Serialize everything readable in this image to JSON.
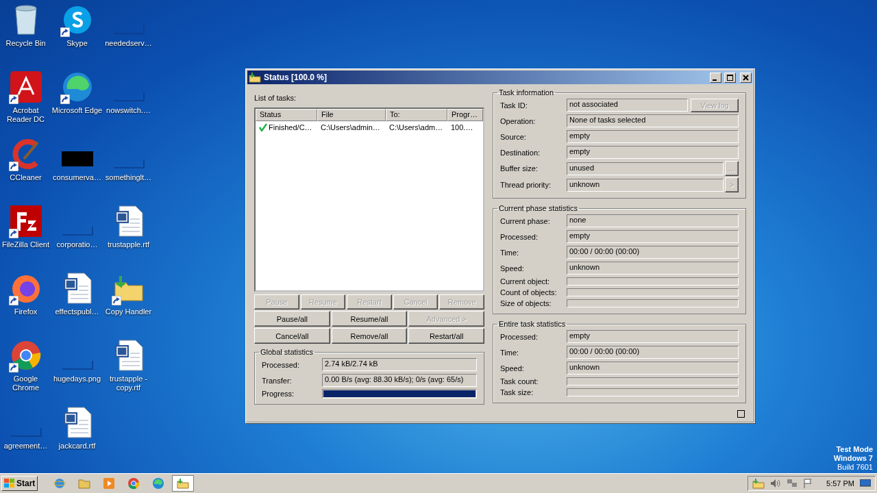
{
  "desktop_icons": [
    {
      "label": "Recycle Bin",
      "kind": "recycle",
      "shortcut": false
    },
    {
      "label": "Acrobat Reader DC",
      "kind": "acrobat",
      "shortcut": true
    },
    {
      "label": "CCleaner",
      "kind": "ccleaner",
      "shortcut": true
    },
    {
      "label": "FileZilla Client",
      "kind": "filezilla",
      "shortcut": true
    },
    {
      "label": "Firefox",
      "kind": "firefox",
      "shortcut": true
    },
    {
      "label": "Google Chrome",
      "kind": "chrome",
      "shortcut": true
    },
    {
      "label": "agreement…",
      "kind": "blank",
      "shortcut": false
    },
    {
      "label": "Skype",
      "kind": "skype",
      "shortcut": true
    },
    {
      "label": "Microsoft Edge",
      "kind": "edge",
      "shortcut": true
    },
    {
      "label": "consumerva…",
      "kind": "black",
      "shortcut": false
    },
    {
      "label": "corporatio…",
      "kind": "blank",
      "shortcut": false
    },
    {
      "label": "effectspubl…",
      "kind": "word",
      "shortcut": false
    },
    {
      "label": "hugedays.png",
      "kind": "blank",
      "shortcut": false
    },
    {
      "label": "jackcard.rtf",
      "kind": "word",
      "shortcut": false
    },
    {
      "label": "neededserv…",
      "kind": "blank",
      "shortcut": false
    },
    {
      "label": "nowswitch.…",
      "kind": "blank",
      "shortcut": false
    },
    {
      "label": "somethinglt…",
      "kind": "blank",
      "shortcut": false
    },
    {
      "label": "trustapple.rtf",
      "kind": "word",
      "shortcut": false
    },
    {
      "label": "Copy Handler",
      "kind": "copyhandler",
      "shortcut": true
    },
    {
      "label": "trustapple - copy.rtf",
      "kind": "word",
      "shortcut": false
    }
  ],
  "window": {
    "title": "Status [100.0 %]",
    "list_label": "List of tasks:",
    "columns": [
      "Status",
      "File",
      "To:",
      "Progr…"
    ],
    "rows": [
      {
        "status": "Finished/C…",
        "file": "C:\\Users\\admin…",
        "to": "C:\\Users\\adm…",
        "progress": "100.…"
      }
    ],
    "task_buttons": [
      {
        "label": "Pause",
        "disabled": true
      },
      {
        "label": "Resume",
        "disabled": true
      },
      {
        "label": "Restart",
        "disabled": true
      },
      {
        "label": "Cancel",
        "disabled": true
      },
      {
        "label": "Remove",
        "disabled": true
      }
    ],
    "all_buttons": [
      {
        "label": "Pause/all",
        "disabled": false
      },
      {
        "label": "Resume/all",
        "disabled": false
      },
      {
        "label": "Advanced >",
        "disabled": true
      },
      {
        "label": "Cancel/all",
        "disabled": false
      },
      {
        "label": "Remove/all",
        "disabled": false
      },
      {
        "label": "Restart/all",
        "disabled": false
      }
    ],
    "global_stats": {
      "title": "Global statistics",
      "rows": [
        {
          "kind": "field",
          "label": "Processed:",
          "value": "2.74 kB/2.74 kB"
        },
        {
          "kind": "field",
          "label": "Transfer:",
          "value": "0.00 B/s (avg: 88.30 kB/s); 0/s (avg: 65/s)"
        },
        {
          "kind": "bar",
          "label": "Progress:",
          "level": 1
        }
      ]
    },
    "groups": [
      {
        "title": "Task information",
        "rows": [
          {
            "kind": "field",
            "label": "Task ID:",
            "value": "not associated",
            "button": {
              "label": "View log",
              "disabled": true,
              "wide": true
            }
          },
          {
            "kind": "field",
            "label": "Operation:",
            "value": "None of tasks selected"
          },
          {
            "kind": "field",
            "label": "Source:",
            "value": "empty"
          },
          {
            "kind": "field",
            "label": "Destination:",
            "value": "empty"
          },
          {
            "kind": "field",
            "label": "Buffer size:",
            "value": "unused",
            "button": {
              "label": "...",
              "disabled": true,
              "wide": false
            }
          },
          {
            "kind": "field",
            "label": "Thread priority:",
            "value": "unknown",
            "button": {
              "label": ">",
              "disabled": true,
              "wide": false
            }
          }
        ]
      },
      {
        "title": "Current phase statistics",
        "rows": [
          {
            "kind": "field",
            "label": "Current phase:",
            "value": "none"
          },
          {
            "kind": "field",
            "label": "Processed:",
            "value": "empty"
          },
          {
            "kind": "field",
            "label": "Time:",
            "value": "00:00 / 00:00 (00:00)"
          },
          {
            "kind": "field",
            "label": "Speed:",
            "value": "unknown"
          },
          {
            "kind": "blank",
            "label": "Current object:"
          },
          {
            "kind": "blank",
            "label": "Count of objects:"
          },
          {
            "kind": "blank",
            "label": "Size of objects:"
          }
        ]
      },
      {
        "title": "Entire task statistics",
        "rows": [
          {
            "kind": "field",
            "label": "Processed:",
            "value": "empty"
          },
          {
            "kind": "field",
            "label": "Time:",
            "value": "00:00 / 00:00 (00:00)"
          },
          {
            "kind": "field",
            "label": "Speed:",
            "value": "unknown"
          },
          {
            "kind": "blank",
            "label": "Task count:"
          },
          {
            "kind": "blank",
            "label": "Task size:"
          }
        ]
      }
    ]
  },
  "os_notice": [
    "Test Mode",
    "Windows 7",
    "Build 7601"
  ],
  "taskbar": {
    "start_label": "Start",
    "apps": [
      {
        "kind": "ie",
        "selected": false
      },
      {
        "kind": "explorer",
        "selected": false
      },
      {
        "kind": "media",
        "selected": false
      },
      {
        "kind": "chrome",
        "selected": false
      },
      {
        "kind": "edge",
        "selected": false
      },
      {
        "kind": "copyhandler",
        "selected": true
      }
    ],
    "tray": [
      {
        "kind": "copyhandler"
      },
      {
        "kind": "speaker"
      },
      {
        "kind": "network"
      },
      {
        "kind": "flag"
      }
    ],
    "time": "5:57 PM"
  }
}
